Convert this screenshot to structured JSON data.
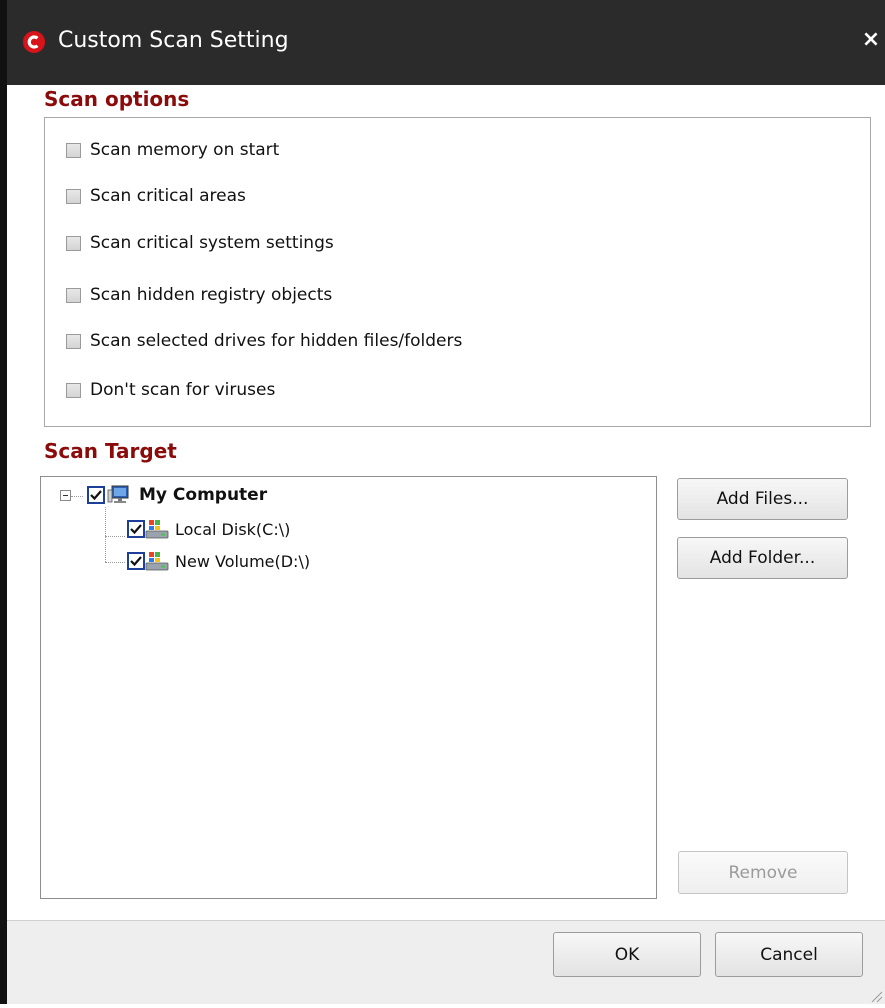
{
  "window": {
    "title": "Custom Scan Setting",
    "close_glyph": "×",
    "logo_letter": "C",
    "accent_color": "#d7141a",
    "heading_color": "#8b0a0a"
  },
  "scan_options": {
    "heading": "Scan options",
    "items": [
      {
        "label": "Scan memory on start",
        "checked": false
      },
      {
        "label": "Scan critical areas",
        "checked": false
      },
      {
        "label": "Scan critical system settings",
        "checked": false
      },
      {
        "label": "Scan hidden registry objects",
        "checked": false
      },
      {
        "label": "Scan selected drives for hidden files/folders",
        "checked": false
      },
      {
        "label": "Don't scan for viruses",
        "checked": false
      }
    ]
  },
  "scan_target": {
    "heading": "Scan Target",
    "tree": {
      "root": {
        "label": "My Computer",
        "checked": true,
        "expanded": true,
        "icon": "computer-icon"
      },
      "children": [
        {
          "label": "Local Disk(C:\\)",
          "checked": true,
          "icon": "drive-icon"
        },
        {
          "label": "New Volume(D:\\)",
          "checked": true,
          "icon": "drive-icon"
        }
      ]
    },
    "buttons": {
      "add_files": "Add Files...",
      "add_folder": "Add Folder...",
      "remove": "Remove"
    }
  },
  "footer": {
    "ok": "OK",
    "cancel": "Cancel"
  }
}
